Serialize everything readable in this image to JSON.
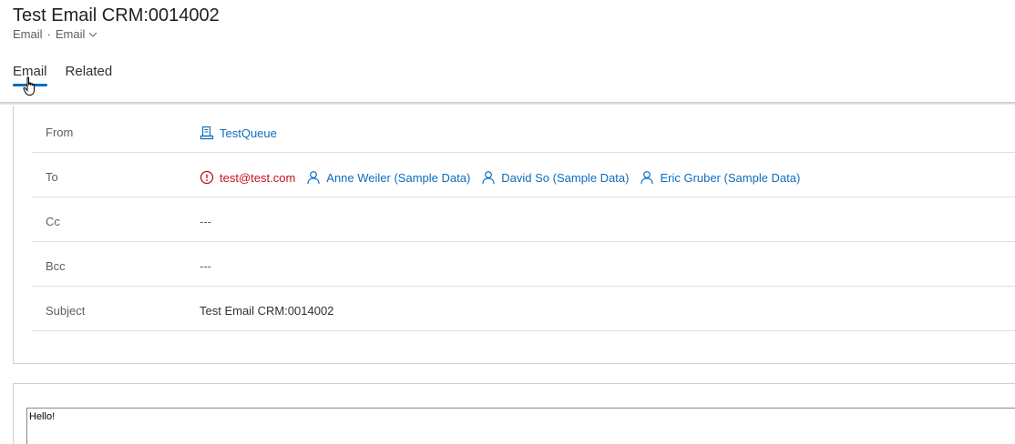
{
  "record": {
    "title": "Test Email CRM:0014002",
    "entity": "Email",
    "separator": "·",
    "form_selector": "Email"
  },
  "tabs": [
    {
      "label": "Email",
      "active": true
    },
    {
      "label": "Related",
      "active": false
    }
  ],
  "fields": {
    "from": {
      "label": "From",
      "value": "TestQueue",
      "icon": "queue-icon"
    },
    "to": {
      "label": "To",
      "recipients": [
        {
          "name": "test@test.com",
          "icon": "error-circle-icon",
          "status": "unresolved"
        },
        {
          "name": "Anne Weiler (Sample Data)",
          "icon": "person-icon"
        },
        {
          "name": "David So (Sample Data)",
          "icon": "person-icon"
        },
        {
          "name": "Eric Gruber (Sample Data)",
          "icon": "person-icon"
        }
      ]
    },
    "cc": {
      "label": "Cc",
      "value": "---"
    },
    "bcc": {
      "label": "Bcc",
      "value": "---"
    },
    "subject": {
      "label": "Subject",
      "value": "Test Email CRM:0014002"
    }
  },
  "body": {
    "text": "Hello!"
  },
  "colors": {
    "accent": "#0f6cbd",
    "error": "#c50f1f",
    "label": "#605e5c",
    "border": "#e1dfdd"
  }
}
